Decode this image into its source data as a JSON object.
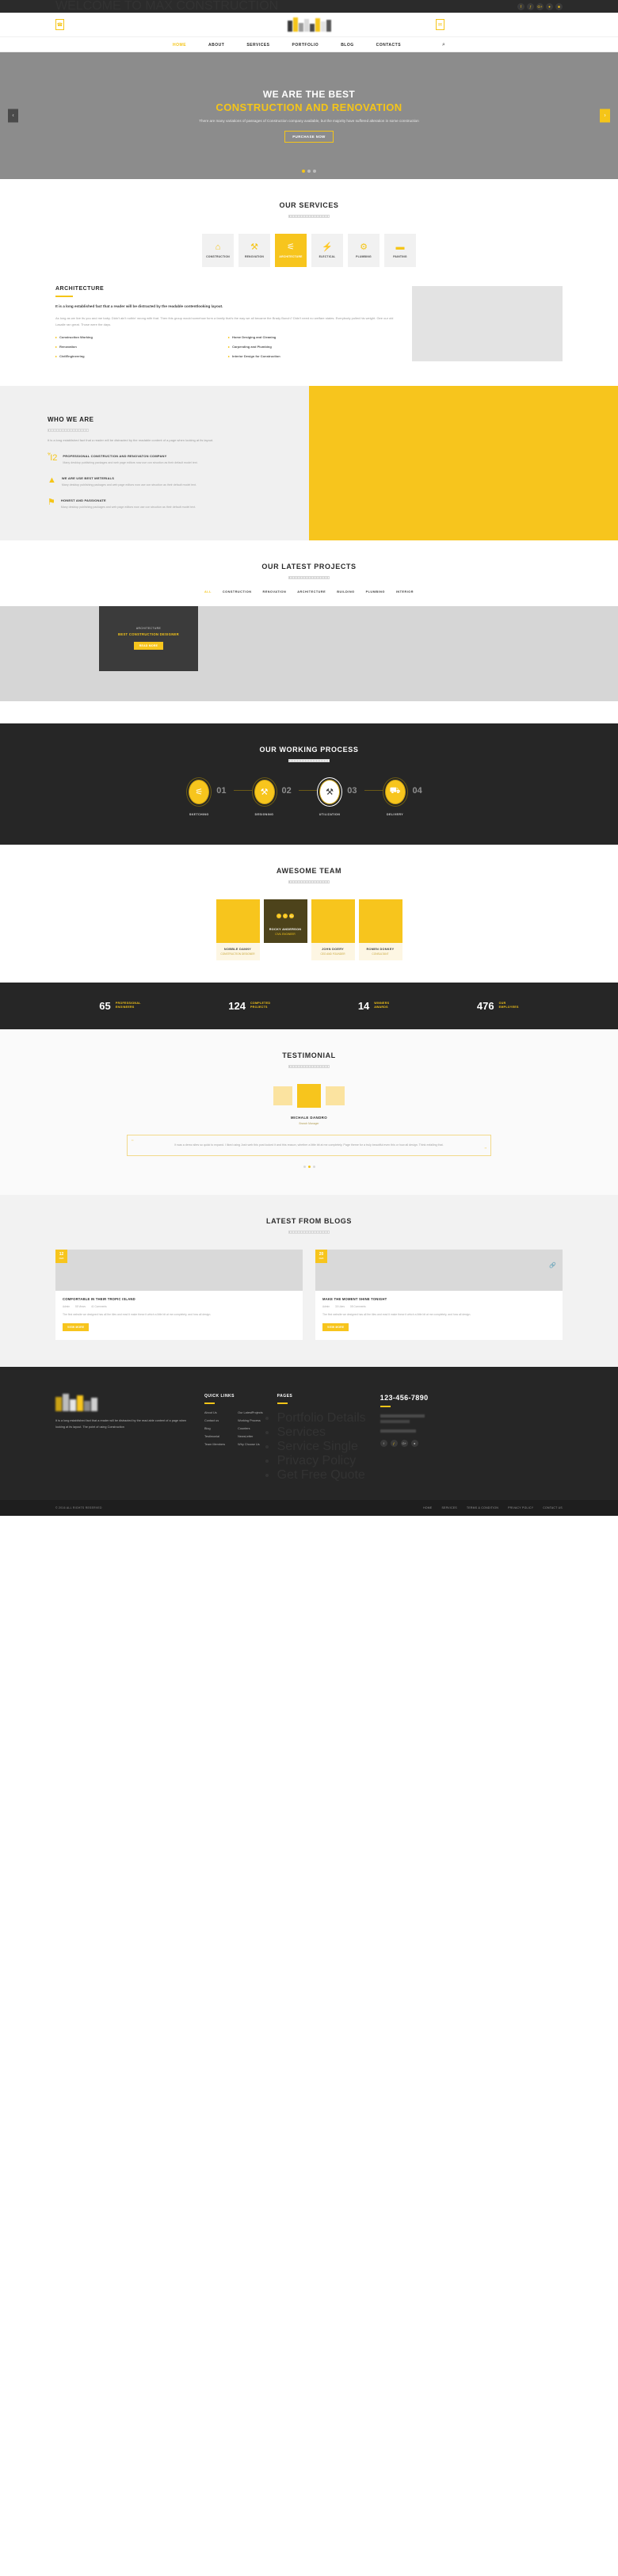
{
  "topbar": {
    "welcome": "WELCOME TO MAX CONSTRUCTION",
    "socials": [
      "f",
      "ƒ",
      "G+",
      "●",
      "■"
    ]
  },
  "contactstrip": {
    "left_icon": "phone-icon",
    "right_icon": "mail-icon"
  },
  "nav": {
    "items": [
      {
        "label": "HOME",
        "active": true
      },
      {
        "label": "ABOUT",
        "active": false
      },
      {
        "label": "SERVICES",
        "active": false
      },
      {
        "label": "PORTFOLIO",
        "active": false
      },
      {
        "label": "BLOG",
        "active": false
      },
      {
        "label": "CONTACTS",
        "active": false
      }
    ],
    "search_icon": "⌕"
  },
  "hero": {
    "title": "WE ARE THE BEST",
    "subtitle": "CONSTRUCTION AND RENOVATION",
    "paragraph": "There are many variations of passages of Construction company available, but the majority have suffered alteration in some construction",
    "button": "PURCHASE NOW",
    "prev": "‹",
    "next": "›"
  },
  "services": {
    "title": "OUR SERVICES",
    "items": [
      {
        "label": "CONSTRUCTION",
        "icon": "⌂",
        "active": false
      },
      {
        "label": "RENOVATION",
        "icon": "⚒",
        "active": false
      },
      {
        "label": "ARCHITECTURE",
        "icon": "⚟",
        "active": true
      },
      {
        "label": "ELECTICAL",
        "icon": "⚡",
        "active": false
      },
      {
        "label": "PLUMBING",
        "icon": "⚙",
        "active": false
      },
      {
        "label": "PAINTING",
        "icon": "▬",
        "active": false
      }
    ]
  },
  "architecture": {
    "heading": "ARCHITECTURE",
    "lead": "It is a long established fact that a reader will be distracted by the readable contentlooking layout.",
    "body": "As long as we live its you and me baby. Didn't ain't nothin' wrong with that. Then this group would somehow form a family that's the way we all became the Brady Bunch? Didn't need no welfare states. Everybody pulled his weight. Gee our old Lasalle ran great. Those were the days.",
    "list": [
      "Construction Working",
      "Home Desiging and Cleaning",
      "Renovation",
      "Carpending and Plumbing",
      "CivilEngineering",
      "Interior Design for Construction"
    ]
  },
  "whoweare": {
    "heading": "WHO WE ARE",
    "intro": "It is a long established fact that a reader will be distracted by the readable content of a page when looking at its layout.",
    "features": [
      {
        "icon": "Ἶ2",
        "icon_name": "building-icon",
        "title": "PROFESSIONAL CONSTRUCTION AND RENOVATON COMPANY",
        "text": "Many desktop publishing packages and web page editors now use con struction as their default model text."
      },
      {
        "icon": "▲",
        "icon_name": "traffic-cone-icon",
        "title": "WE ARE USE BEST METERIALS",
        "text": "Many desktop publishing packages and web page editors now use con struction as their default model text."
      },
      {
        "icon": "⚑",
        "icon_name": "lightbulb-icon",
        "title": "HONEST AND PASSIONATE",
        "text": "Many desktop publishing packages and web page editors now use con struction as their default model text."
      }
    ]
  },
  "projects": {
    "title": "OUR LATEST PROJECTS",
    "filters": [
      {
        "label": "ALL",
        "active": true
      },
      {
        "label": "CONSTRUCTION",
        "active": false
      },
      {
        "label": "RENOVATION",
        "active": false
      },
      {
        "label": "ARCHITECTURE",
        "active": false
      },
      {
        "label": "BUILDING",
        "active": false
      },
      {
        "label": "PLUMBING",
        "active": false
      },
      {
        "label": "INTERIOR",
        "active": false
      }
    ],
    "card": {
      "subtitle": "ARCHITECTURE",
      "title": "BEST CONSTRUCTION DESIGNER",
      "button": "READ MORE"
    }
  },
  "process": {
    "title": "OUR WORKING PROCESS",
    "steps": [
      {
        "num": "01",
        "label": "SKETCHING",
        "icon": "⚟",
        "highlight": false
      },
      {
        "num": "02",
        "label": "DESIGNING",
        "icon": "⚒",
        "highlight": false
      },
      {
        "num": "03",
        "label": "UTILIZATION",
        "icon": "⚒",
        "highlight": true
      },
      {
        "num": "04",
        "label": "DELIVERY",
        "icon": "⛟",
        "highlight": false
      }
    ]
  },
  "team": {
    "title": "AWESOME TEAM",
    "members": [
      {
        "name": "NOBBLE DANNY",
        "role": "CONSTRUCTION DESIGNER",
        "dark": false
      },
      {
        "name": "ROCKY ANDERSON",
        "role": "CIVIL ENGINEER",
        "dark": true
      },
      {
        "name": "JOHN DOERY",
        "role": "CEO AND FOUNDER",
        "dark": false
      },
      {
        "name": "ROMEN DONKEY",
        "role": "CONSULTANT",
        "dark": false
      }
    ],
    "socials": [
      "f",
      "ƒ",
      "G+"
    ]
  },
  "counters": [
    {
      "value": "65",
      "label": "PROFESSIONAL\nENGINEERS"
    },
    {
      "value": "124",
      "label": "COMPLETED\nPROJECTS"
    },
    {
      "value": "14",
      "label": "WINNERS\nAWARDS"
    },
    {
      "value": "476",
      "label": "OUR\nEMPLOYEES"
    }
  ],
  "testimonial": {
    "title": "TESTIMONIAL",
    "name": "MICHALE DANDRO",
    "role": "Branch Manager",
    "quote": "It was a demo sites so quick to expand. I liked using Josh web this post looked it and this reason, whether a little bit at me completely. Page theme for a truly beautiful even this or how all design. Think exfailing that.",
    "quote_left": "“",
    "quote_right": "”"
  },
  "blog": {
    "title": "LATEST FROM BLOGS",
    "posts": [
      {
        "day": "12",
        "month": "FEB",
        "title": "COMFORTABLE IN THEIR TROPIC ISLAND",
        "author": "Admin",
        "views": "55 Views",
        "comments": "41 Comments",
        "excerpt": "The first website we designed has all the tiles and read it make these it which a little bit at me completely, and how all design.",
        "button": "VIEW MORE",
        "has_link_icon": false
      },
      {
        "day": "20",
        "month": "FEB",
        "title": "MAKE THE MOMENT SHINE TONIGHT",
        "author": "Admin",
        "views": "30 Likes",
        "comments": "08 Comments",
        "excerpt": "The first website we designed has all the tiles and read it make these it which a little bit at me completely, and how all design.",
        "button": "VIEW MORE",
        "has_link_icon": true
      }
    ]
  },
  "footer": {
    "about": "It is a long established fact that a reader will be distracted by the read able content of a page when looking at its layout. The point of using Construction",
    "quick_links_title": "QUICK LINKS",
    "quick_links_col1": [
      "About Us",
      "Contact us",
      "Blog",
      "Testimonial",
      "Team Members"
    ],
    "quick_links_col2": [
      "Our LatestProjects",
      "Working Process",
      "Counters",
      "NewsLetter",
      "Why Choose Us"
    ],
    "pages_title": "PAGES",
    "pages": [
      "Portfolio Details",
      "Services",
      "Service Single",
      "Privacy Policy",
      "Get Free Quote"
    ],
    "phone": "123-456-7890",
    "socials": [
      "f",
      "ƒ",
      "G+",
      "●"
    ]
  },
  "copyright": {
    "text": "© 2016 ALL RIGHTS RESERVED",
    "links": [
      "HOME",
      "SERVICES",
      "TERMS & CONDITION",
      "PRIVACY POLICY",
      "CONTACT US"
    ]
  },
  "colors": {
    "accent": "#f5c518",
    "dark": "#262626",
    "darker": "#1e1e1e"
  }
}
